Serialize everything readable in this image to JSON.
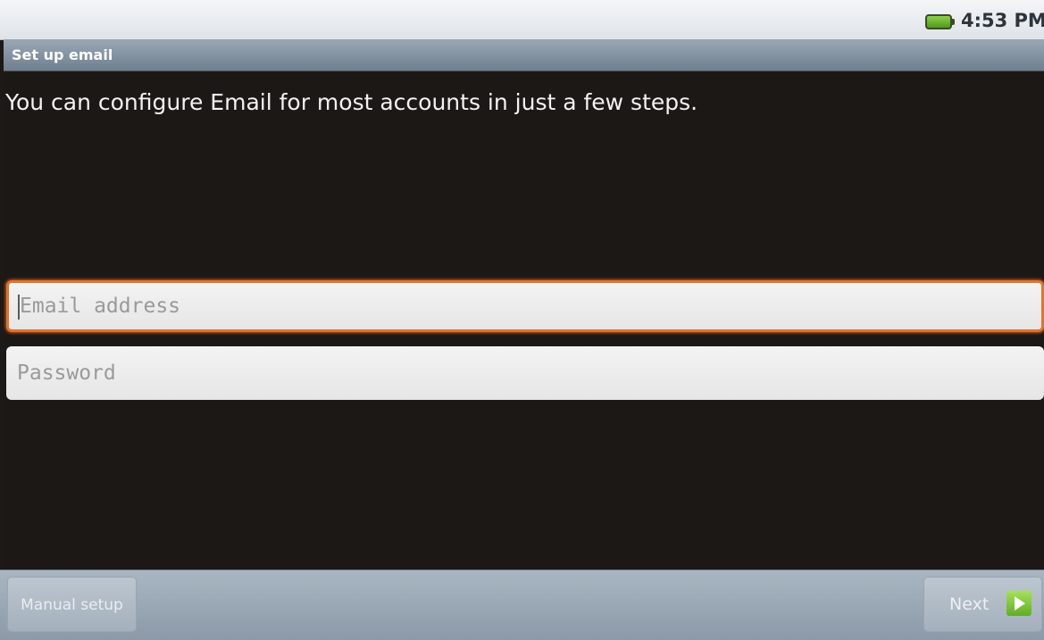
{
  "status_bar": {
    "time": "4:53 PM",
    "battery_icon": "battery-icon"
  },
  "title_bar": {
    "title": "Set up email"
  },
  "content": {
    "instructions": "You can configure Email for most accounts in just a few steps.",
    "email_field": {
      "placeholder": "Email address",
      "value": ""
    },
    "password_field": {
      "placeholder": "Password",
      "value": ""
    }
  },
  "bottom_bar": {
    "manual_setup_label": "Manual setup",
    "next_label": "Next",
    "next_icon": "arrow-right-icon"
  },
  "colors": {
    "focus_border": "#e0742c",
    "next_icon_green": "#6fbf2c",
    "battery_green": "#6cb832"
  }
}
